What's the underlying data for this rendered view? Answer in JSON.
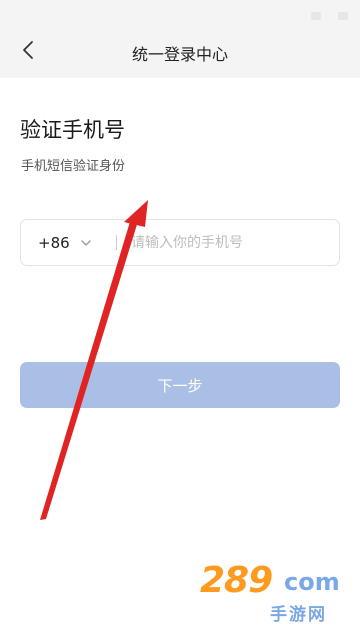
{
  "header": {
    "title": "统一登录中心",
    "back_icon": "chevron-left-icon"
  },
  "main": {
    "title": "验证手机号",
    "subtitle": "手机短信验证身份",
    "phone": {
      "country_code": "+86",
      "dropdown_icon": "chevron-down-icon",
      "placeholder": "请输入你的手机号",
      "value": ""
    },
    "next_button": {
      "label": "下一步",
      "enabled": false,
      "color": "#aabfe6"
    }
  },
  "watermark": {
    "main": "289",
    "suffix": "com",
    "sub": "手游网"
  },
  "colors": {
    "header_bg": "#f4f4f4",
    "annotation_arrow": "#e02424",
    "watermark_orange": "#ff9a1f",
    "watermark_blue": "#7aa7e6"
  }
}
